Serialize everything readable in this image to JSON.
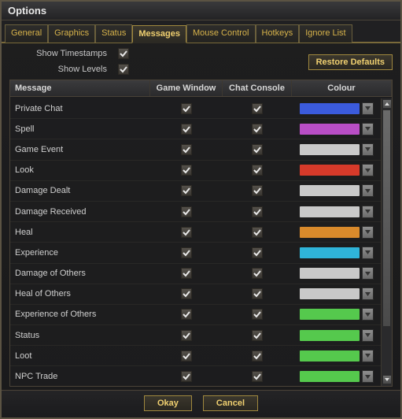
{
  "window": {
    "title": "Options"
  },
  "tabs": [
    {
      "label": "General",
      "active": false
    },
    {
      "label": "Graphics",
      "active": false
    },
    {
      "label": "Status",
      "active": false
    },
    {
      "label": "Messages",
      "active": true
    },
    {
      "label": "Mouse Control",
      "active": false
    },
    {
      "label": "Hotkeys",
      "active": false
    },
    {
      "label": "Ignore List",
      "active": false
    }
  ],
  "toggles": {
    "timestamps_label": "Show Timestamps",
    "timestamps_checked": true,
    "levels_label": "Show Levels",
    "levels_checked": true
  },
  "buttons": {
    "restore": "Restore Defaults",
    "okay": "Okay",
    "cancel": "Cancel"
  },
  "columns": {
    "message": "Message",
    "game_window": "Game Window",
    "chat_console": "Chat Console",
    "colour": "Colour"
  },
  "rows": [
    {
      "name": "Private Chat",
      "gw": true,
      "cc": true,
      "color": "#3b5bdc"
    },
    {
      "name": "Spell",
      "gw": true,
      "cc": true,
      "color": "#b94ec6"
    },
    {
      "name": "Game Event",
      "gw": true,
      "cc": true,
      "color": "#c9c9c9"
    },
    {
      "name": "Look",
      "gw": true,
      "cc": true,
      "color": "#d63a2a"
    },
    {
      "name": "Damage Dealt",
      "gw": true,
      "cc": true,
      "color": "#c9c9c9"
    },
    {
      "name": "Damage Received",
      "gw": true,
      "cc": true,
      "color": "#c9c9c9"
    },
    {
      "name": "Heal",
      "gw": true,
      "cc": true,
      "color": "#d98a2b"
    },
    {
      "name": "Experience",
      "gw": true,
      "cc": true,
      "color": "#2fb4d9"
    },
    {
      "name": "Damage of Others",
      "gw": true,
      "cc": true,
      "color": "#c9c9c9"
    },
    {
      "name": "Heal of Others",
      "gw": true,
      "cc": true,
      "color": "#c9c9c9"
    },
    {
      "name": "Experience of Others",
      "gw": true,
      "cc": true,
      "color": "#55c94d"
    },
    {
      "name": "Status",
      "gw": true,
      "cc": true,
      "color": "#55c94d"
    },
    {
      "name": "Loot",
      "gw": true,
      "cc": true,
      "color": "#55c94d"
    },
    {
      "name": "NPC Trade",
      "gw": true,
      "cc": true,
      "color": "#55c94d"
    }
  ]
}
